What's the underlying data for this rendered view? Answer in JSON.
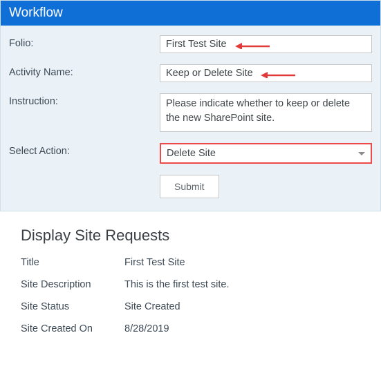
{
  "workflow": {
    "header": "Workflow",
    "folio_label": "Folio:",
    "folio_value": "First Test Site",
    "activity_label": "Activity Name:",
    "activity_value": "Keep or Delete Site",
    "instruction_label": "Instruction:",
    "instruction_value": "Please indicate whether to keep or delete the new SharePoint site.",
    "select_label": "Select Action:",
    "select_value": "Delete Site",
    "submit_label": "Submit"
  },
  "details": {
    "heading": "Display Site Requests",
    "title_label": "Title",
    "title_value": "First Test Site",
    "desc_label": "Site Description",
    "desc_value": "This is the first test site.",
    "status_label": "Site Status",
    "status_value": "Site Created",
    "created_label": "Site Created On",
    "created_value": "8/28/2019"
  }
}
